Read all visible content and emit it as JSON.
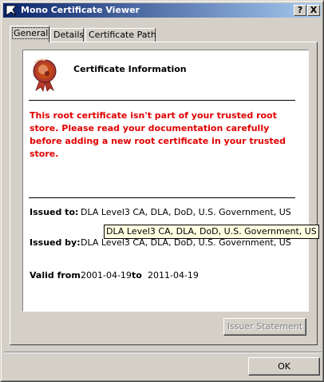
{
  "window": {
    "title": "Mono Certificate Viewer",
    "help_button": "?",
    "close_button": "X"
  },
  "tabs": [
    {
      "label": "General",
      "active": true
    },
    {
      "label": "Details",
      "active": false
    },
    {
      "label": "Certificate Path",
      "active": false
    }
  ],
  "general": {
    "heading": "Certificate Information",
    "warning": "This root certificate isn't part of your trusted root store. Please read your documentation carefully before adding a new root certificate in your trusted store.",
    "issued_to_label": "Issued to:",
    "issued_to_value": "DLA Level3 CA, DLA, DoD, U.S. Government, US",
    "tooltip": "DLA Level3 CA, DLA, DoD, U.S. Government, US",
    "issued_by_label": "Issued by:",
    "issued_by_value": "DLA Level3 CA, DLA, DoD, U.S. Government, US",
    "valid_from_label": "Valid from",
    "valid_from_value": "2001-04-19",
    "valid_to_label": "to",
    "valid_to_value": "2011-04-19",
    "issuer_statement_button": "Issuer Statement"
  },
  "footer": {
    "ok_button": "OK"
  },
  "colors": {
    "warning": "#e00000",
    "titlebar_start": "#0a246a",
    "titlebar_end": "#a6caf0",
    "tooltip_bg": "#ffffe1"
  }
}
